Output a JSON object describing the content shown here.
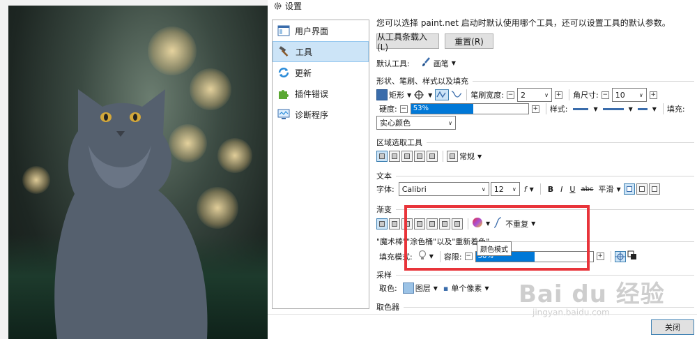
{
  "window": {
    "title": "设置"
  },
  "sidebar": {
    "items": [
      {
        "label": "用户界面",
        "icon": "window-icon"
      },
      {
        "label": "工具",
        "icon": "hammer-icon"
      },
      {
        "label": "更新",
        "icon": "refresh-icon"
      },
      {
        "label": "插件错误",
        "icon": "puzzle-icon"
      },
      {
        "label": "诊断程序",
        "icon": "monitor-icon"
      }
    ]
  },
  "intro": "您可以选择 paint.net 启动时默认使用哪个工具，还可以设置工具的默认参数。",
  "buttons": {
    "load_from_toolbar": "从工具条载入(L)",
    "reset": "重置(R)",
    "close": "关闭"
  },
  "default_tool": {
    "label": "默认工具:",
    "value": "画笔"
  },
  "shapes": {
    "section": "形状、笔刷、样式以及填充",
    "shape": "矩形",
    "brush_width_label": "笔刷宽度:",
    "brush_width": "2",
    "corner_label": "角尺寸:",
    "corner": "10",
    "hardness_label": "硬度:",
    "hardness": "53%",
    "hardness_fraction": 0.53,
    "style_label": "样式:",
    "fill_label": "填充:",
    "fill_value": "实心颜色"
  },
  "selection": {
    "section": "区域选取工具",
    "mode": "常规"
  },
  "text": {
    "section": "文本",
    "font_label": "字体:",
    "font": "Calibri",
    "size": "12",
    "bold": "B",
    "italic": "I",
    "underline": "U",
    "strike": "abc",
    "smoothing": "平滑"
  },
  "gradient": {
    "section": "渐变",
    "repeat": "不重复"
  },
  "magic": {
    "section": "\"魔术棒\"\"涂色桶\"以及\"重新着色\"",
    "fill_mode_label": "填充模式:",
    "tolerance_label": "容限:",
    "tolerance": "50%",
    "tolerance_fraction": 0.5,
    "tooltip": "颜色模式"
  },
  "sampling": {
    "section": "采样",
    "sample_label": "取色:",
    "layer": "图层",
    "pixel": "单个像素"
  },
  "picker": {
    "section": "取色器"
  },
  "watermark": {
    "big": "Bai du 经验",
    "small": "jingyan.baidu.com"
  },
  "colors": {
    "accent": "#0078d7",
    "highlight": "#cce4f7",
    "annotation": "#e8343a"
  }
}
